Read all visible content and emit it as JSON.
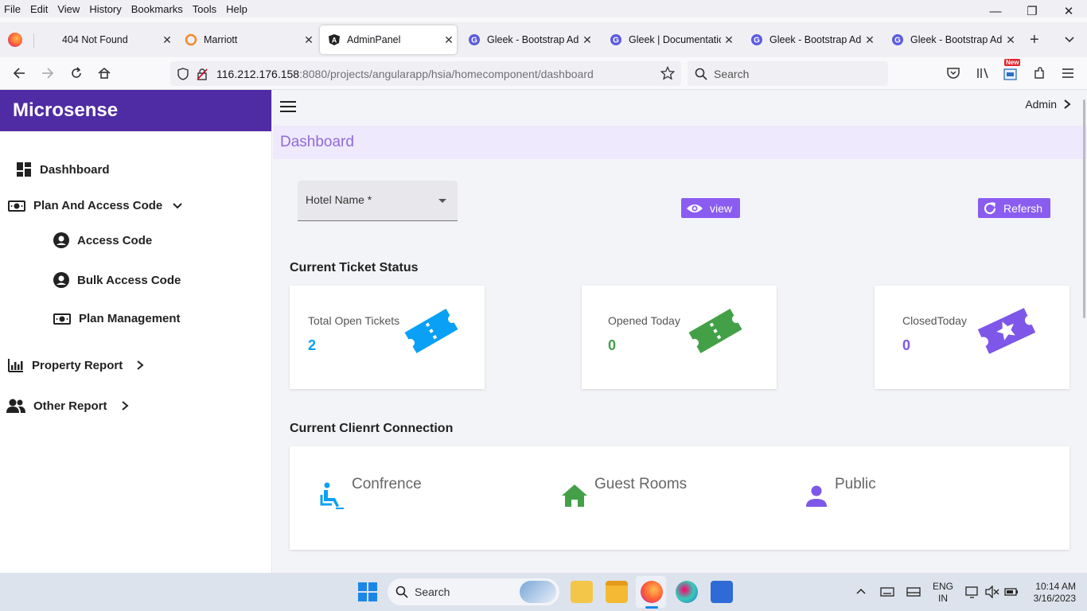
{
  "browser": {
    "menu": [
      "File",
      "Edit",
      "View",
      "History",
      "Bookmarks",
      "Tools",
      "Help"
    ],
    "tabs": [
      {
        "label": "404 Not Found"
      },
      {
        "label": "Marriott"
      },
      {
        "label": "AdminPanel"
      },
      {
        "label": "Gleek - Bootstrap Adm"
      },
      {
        "label": "Gleek | Documentation"
      },
      {
        "label": "Gleek - Bootstrap Adm"
      },
      {
        "label": "Gleek - Bootstrap Adm"
      }
    ],
    "url_host": "116.212.176.158",
    "url_path": ":8080/projects/angularapp/hsia/homecomponent/dashboard",
    "search_placeholder": "Search",
    "new_badge": "New"
  },
  "sidebar": {
    "brand": "Microsense",
    "items": [
      {
        "label": "Dashhboard"
      },
      {
        "label": "Plan And Access Code"
      },
      {
        "label": "Access Code"
      },
      {
        "label": "Bulk Access Code"
      },
      {
        "label": "Plan Management"
      },
      {
        "label": "Property Report"
      },
      {
        "label": "Other Report"
      }
    ]
  },
  "header": {
    "user": "Admin",
    "breadcrumb": "Dashboard"
  },
  "filters": {
    "hotel_label": "Hotel Name *",
    "view_label": "view",
    "refresh_label": "Refersh"
  },
  "tickets": {
    "heading": "Current Ticket Status",
    "cards": [
      {
        "title": "Total Open Tickets",
        "value": "2",
        "color": "#0aa0f5"
      },
      {
        "title": "Opened Today",
        "value": "0",
        "color": "#43a047"
      },
      {
        "title": "ClosedToday",
        "value": "0",
        "color": "#7e57e8"
      }
    ]
  },
  "connections": {
    "heading": "Current Clienrt Connection",
    "items": [
      {
        "label": "Confrence",
        "icon": "accessible-icon",
        "color": "#0aa0f5"
      },
      {
        "label": "Guest Rooms",
        "icon": "home-icon",
        "color": "#43a047"
      },
      {
        "label": "Public",
        "icon": "person-icon",
        "color": "#7e57e8"
      }
    ]
  },
  "taskbar": {
    "search_label": "Search",
    "lang": "ENG",
    "region": "IN",
    "time": "10:14 AM",
    "date": "3/16/2023"
  }
}
